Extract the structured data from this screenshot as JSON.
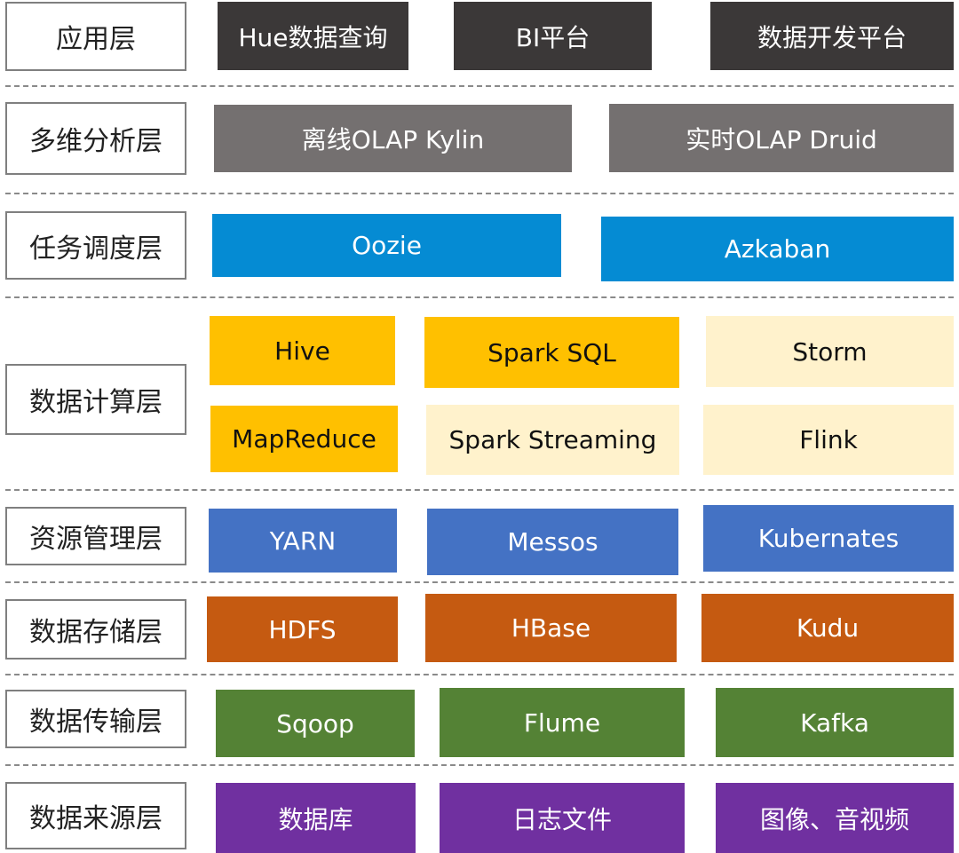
{
  "layers": [
    {
      "name": "应用层",
      "components": [
        "Hue数据查询",
        "BI平台",
        "数据开发平台"
      ]
    },
    {
      "name": "多维分析层",
      "components": [
        "离线OLAP Kylin",
        "实时OLAP Druid"
      ]
    },
    {
      "name": "任务调度层",
      "components": [
        "Oozie",
        "Azkaban"
      ]
    },
    {
      "name": "数据计算层",
      "components": [
        "Hive",
        "Spark SQL",
        "Storm",
        "MapReduce",
        "Spark Streaming",
        "Flink"
      ]
    },
    {
      "name": "资源管理层",
      "components": [
        "YARN",
        "Messos",
        "Kubernates"
      ]
    },
    {
      "name": "数据存储层",
      "components": [
        "HDFS",
        "HBase",
        "Kudu"
      ]
    },
    {
      "name": "数据传输层",
      "components": [
        "Sqoop",
        "Flume",
        "Kafka"
      ]
    },
    {
      "name": "数据来源层",
      "components": [
        "数据库",
        "日志文件",
        "图像、音视频"
      ]
    }
  ],
  "colors": {
    "application": "#3b3838",
    "olap": "#747070",
    "scheduling": "#058bd3",
    "compute_batch": "#ffc000",
    "compute_stream": "#fff2cc",
    "resource": "#4472c4",
    "storage": "#c55a11",
    "transport": "#548235",
    "source": "#7030a0"
  }
}
